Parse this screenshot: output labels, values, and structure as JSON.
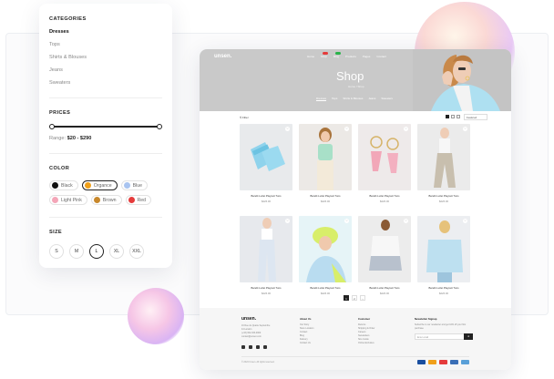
{
  "filters": {
    "categories_title": "CATEGORIES",
    "categories": [
      {
        "label": "Dresses",
        "active": true
      },
      {
        "label": "Tops",
        "active": false
      },
      {
        "label": "Shirts & Blouses",
        "active": false
      },
      {
        "label": "Jeans",
        "active": false
      },
      {
        "label": "Sweaters",
        "active": false
      }
    ],
    "prices_title": "PRICES",
    "range_label": "Range:",
    "range_value": "$20 - $290",
    "color_title": "COLOR",
    "colors": [
      {
        "label": "Black",
        "hex": "#111111",
        "active": false
      },
      {
        "label": "Organce",
        "hex": "#f0a01a",
        "active": true
      },
      {
        "label": "Blue",
        "hex": "#a9c4f0",
        "active": false
      },
      {
        "label": "Light Pink",
        "hex": "#f4a6b8",
        "active": false
      },
      {
        "label": "Brown",
        "hex": "#c8882c",
        "active": false
      },
      {
        "label": "Red",
        "hex": "#e53b3b",
        "active": false
      }
    ],
    "size_title": "SIZE",
    "sizes": [
      {
        "label": "S",
        "active": false
      },
      {
        "label": "M",
        "active": false
      },
      {
        "label": "L",
        "active": true
      },
      {
        "label": "XL",
        "active": false
      },
      {
        "label": "XXL",
        "active": false
      }
    ]
  },
  "site": {
    "logo": "unsen.",
    "nav": [
      "Home",
      "Shop",
      "Blog",
      "Products",
      "Pages",
      "Contact"
    ],
    "badges": [
      {
        "index": 1,
        "hex": "#e53b3b"
      },
      {
        "index": 2,
        "hex": "#2ab34a"
      }
    ],
    "header_icons": [
      "search-icon",
      "user-icon",
      "bag-icon"
    ],
    "hero_title": "Shop",
    "breadcrumb": "Home  /  Shop",
    "tabs": [
      {
        "label": "Dresses",
        "active": true
      },
      {
        "label": "Tops",
        "active": false
      },
      {
        "label": "Shirts & Blouses",
        "active": false
      },
      {
        "label": "Jeans",
        "active": false
      },
      {
        "label": "Sweaters",
        "active": false
      }
    ],
    "filter_label": "Filter",
    "sort_label": "Featured",
    "products": [
      {
        "title": "Bandit Lurlet Playsuit Tuns",
        "price": "$226.00",
        "bg": "#e8eaec"
      },
      {
        "title": "Bandit Lurlet Playsuit Tuns",
        "price": "$226.00",
        "bg": "#ece9e6"
      },
      {
        "title": "Bandit Lurlet Playsuit Tuns",
        "price": "$226.00",
        "bg": "#eeeaea"
      },
      {
        "title": "Bandit Lurlet Playsuit Tuns",
        "price": "$226.00",
        "bg": "#ebebeb"
      },
      {
        "title": "Bandit Lurlet Playsuit Tuns",
        "price": "$226.00",
        "bg": "#e7e9ed"
      },
      {
        "title": "Bandit Lurlet Playsuit Tuns",
        "price": "$226.00",
        "bg": "#e6f4f7"
      },
      {
        "title": "Bandit Lurlet Playsuit Tuns",
        "price": "$226.00",
        "bg": "#ececec"
      },
      {
        "title": "Bandit Lurlet Playsuit Tuns",
        "price": "$226.00",
        "bg": "#eceef1"
      }
    ],
    "pages": [
      "1",
      "2",
      "›"
    ],
    "footer": {
      "logo": "unsen.",
      "address": [
        "16 Rue du Quatre Septembre",
        "44 Landon",
        "(+33) 362-333-0000",
        "contact@unsen.com"
      ],
      "col1_title": "About Us",
      "col1": [
        "Our Story",
        "Store Location",
        "Contact",
        "Blog",
        "Delivery",
        "Contact Us"
      ],
      "col2_title": "Customer",
      "col2": [
        "Returns",
        "Shipping & Order",
        "Careers",
        "Newsletters",
        "Size Guide",
        "Online Exclusive"
      ],
      "col3_title": "Newsletter Signup",
      "col3_text": "Subscribe to our newsletter and get 10% off your first purchase",
      "subscribe_placeholder": "Enter email",
      "copyright": "© 2024 Unsen. All rights reserved.",
      "payments": [
        "#1a4fa0",
        "#f0a01a",
        "#e53b3b",
        "#3b6fb6",
        "#5aa0d8"
      ]
    }
  }
}
